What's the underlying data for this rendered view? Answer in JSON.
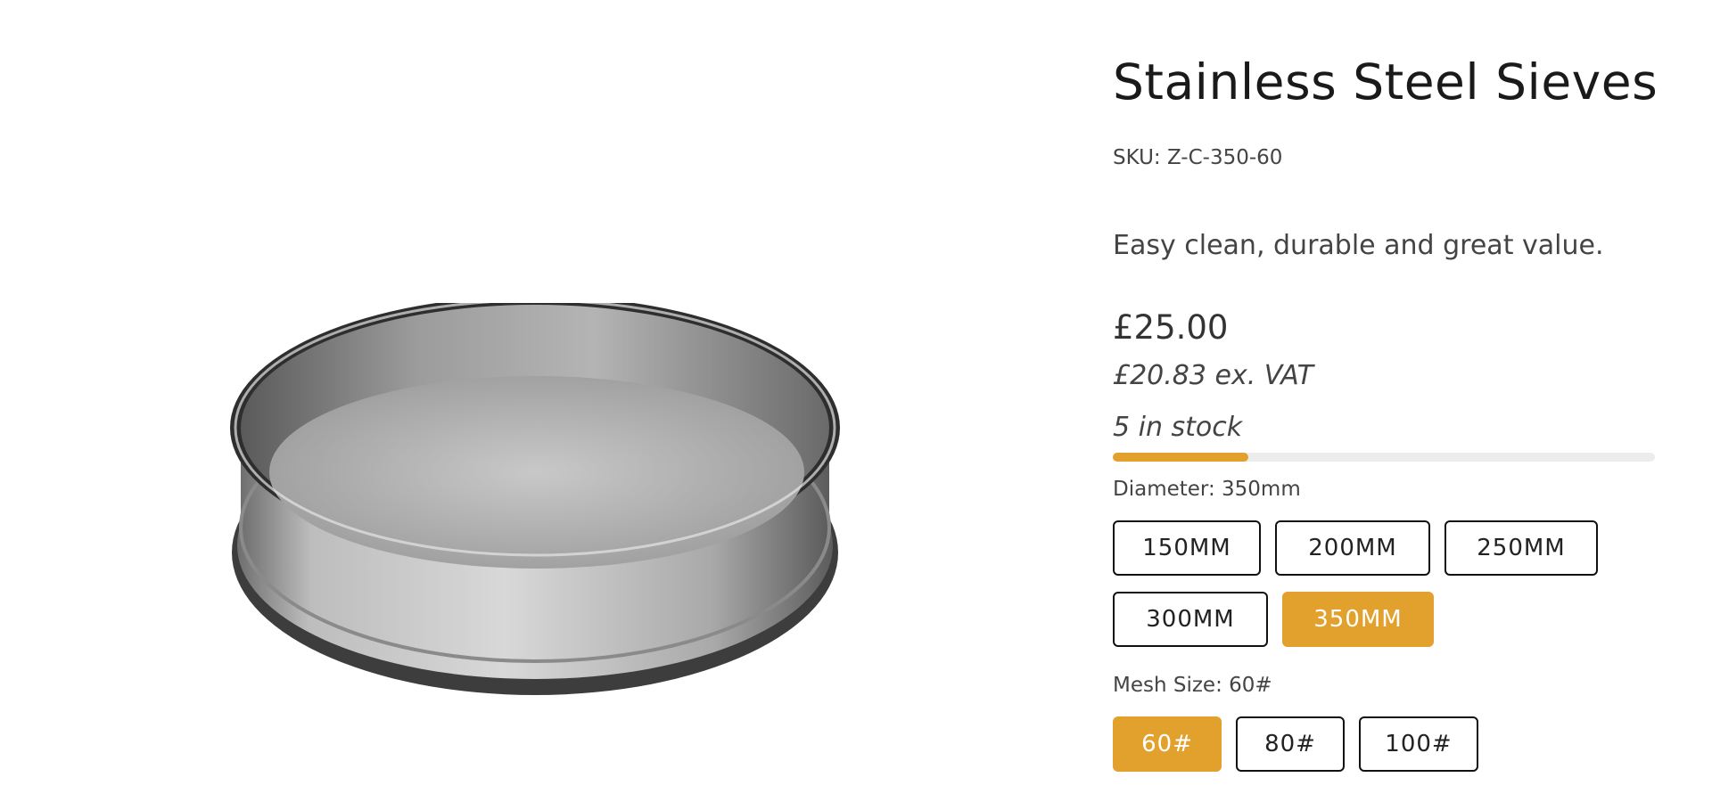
{
  "product": {
    "title": "Stainless Steel Sieves",
    "sku": "SKU: Z-C-350-60",
    "tagline": "Easy clean, durable and great value.",
    "price": "£25.00",
    "price_ex_vat": "£20.83 ex. VAT",
    "stock_text": "5 in stock",
    "stock_fill_fraction": 0.25,
    "accent_color": "#e2a12c",
    "image_icon": "stainless-steel-sieve-photo"
  },
  "diameter": {
    "label": "Diameter: 350mm",
    "options": [
      "150MM",
      "200MM",
      "250MM",
      "300MM",
      "350MM"
    ],
    "selected": "350MM"
  },
  "mesh": {
    "label": "Mesh Size: 60#",
    "options": [
      "60#",
      "80#",
      "100#"
    ],
    "selected": "60#"
  }
}
